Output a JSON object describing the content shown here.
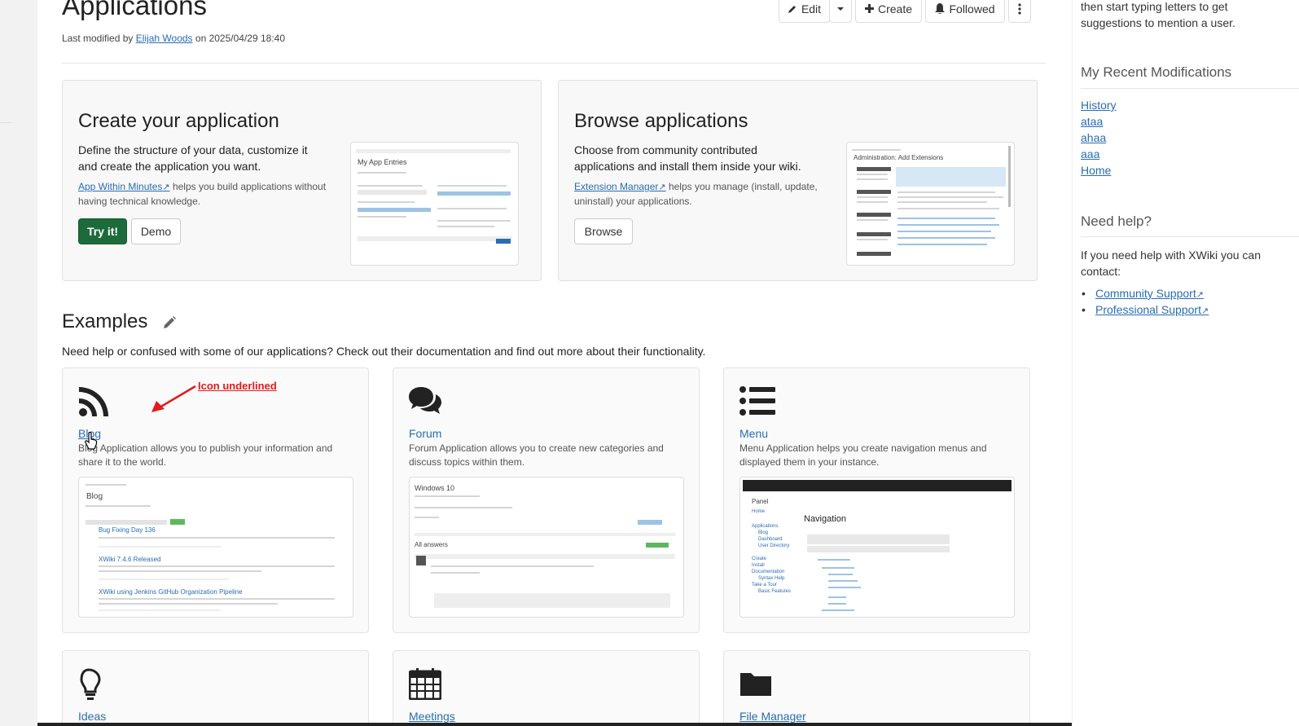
{
  "page": {
    "title": "Applications",
    "meta_prefix": "Last modified by",
    "meta_author": "Elijah Woods",
    "meta_date": "on 2025/04/29 18:40"
  },
  "toolbar": {
    "edit": "Edit",
    "create": "Create",
    "followed": "Followed"
  },
  "create_panel": {
    "title": "Create your application",
    "desc": "Define the structure of your data, customize it and create the application you want.",
    "link": "App Within Minutes",
    "sub": " helps you build applications without having technical knowledge.",
    "try_label": "Try it!",
    "demo_label": "Demo",
    "thumb_title": "My App Entries"
  },
  "browse_panel": {
    "title": "Browse applications",
    "desc": "Choose from community contributed applications and install them inside your wiki.",
    "link": "Extension Manager",
    "sub": " helps you manage (install, update, uninstall) your applications.",
    "browse_label": "Browse",
    "thumb_title": "Administration: Add Extensions"
  },
  "examples": {
    "title": "Examples",
    "desc": "Need help or confused with some of our applications? Check out their documentation and find out more about their functionality.",
    "cards": [
      {
        "name": "Blog",
        "desc": "Blog Application allows you to publish your information and share it to the world.",
        "shot_title": "Blog",
        "entries": [
          "Bug Fixing Day 136",
          "XWiki 7.4.6 Released",
          "XWiki using Jenkins GitHub Organization Pipeline"
        ]
      },
      {
        "name": "Forum",
        "desc": "Forum Application allows you to create new categories and discuss topics within them.",
        "shot_title": "Windows 10",
        "shot_answers": "All answers"
      },
      {
        "name": "Menu",
        "desc": "Menu Application helps you create navigation menus and displayed them in your instance.",
        "shot_panel": "Panel",
        "shot_title": "Navigation",
        "nav_items": [
          "Home",
          "Applications",
          "Blog",
          "Dashboard",
          "User Directory",
          "Create",
          "Install",
          "Documentation",
          "Syntax Help",
          "Take a Tour",
          "Basic Features"
        ]
      },
      {
        "name": "Ideas"
      },
      {
        "name": "Meetings"
      },
      {
        "name": "File Manager"
      }
    ]
  },
  "annotation": {
    "text": "Icon underlined"
  },
  "sidebar": {
    "hint": "then start typing letters to get suggestions to mention a user.",
    "recent_title": "My Recent Modifications",
    "recent": [
      "History",
      "ataa",
      "ahaa",
      "aaa",
      "Home"
    ],
    "help_title": "Need help?",
    "help_text": "If you need help with XWiki you can contact:",
    "help_links": [
      "Community Support",
      "Professional Support"
    ]
  },
  "colors": {
    "link": "#2a6db0",
    "primary_button": "#1d6b3a",
    "annotation": "#e21b1b"
  }
}
